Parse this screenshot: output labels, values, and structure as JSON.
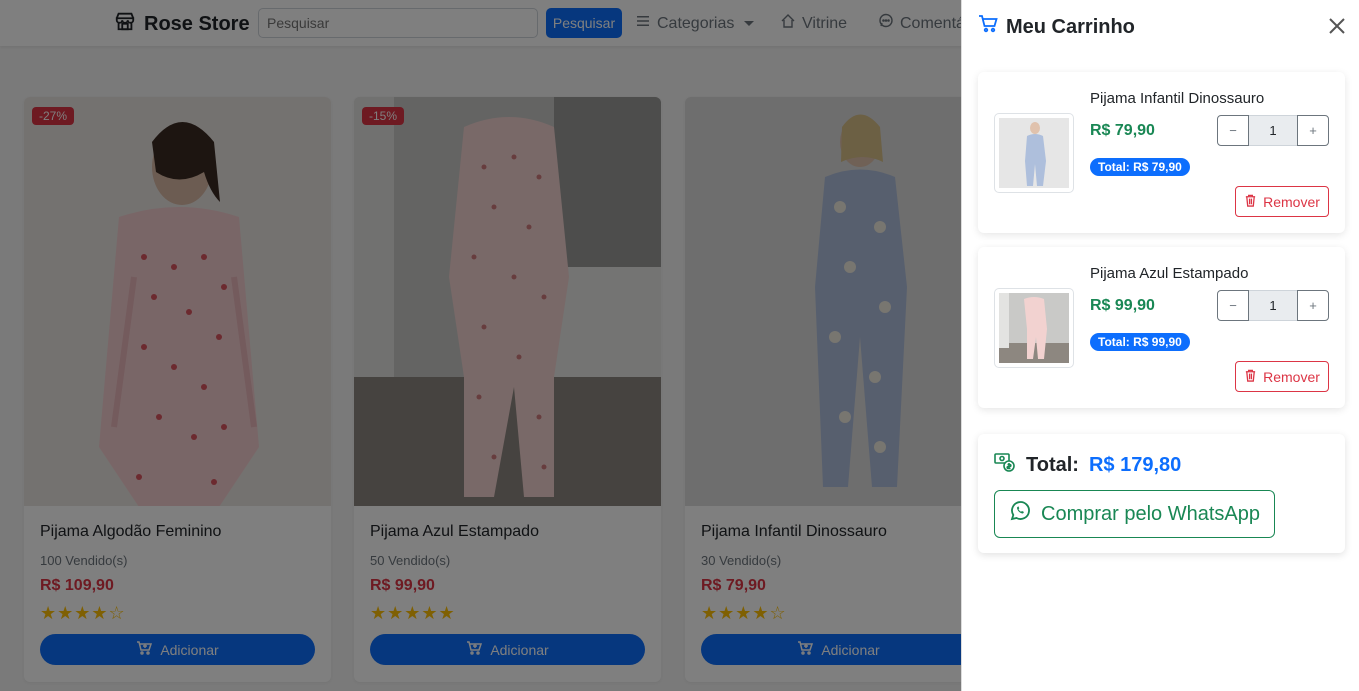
{
  "navbar": {
    "brand": "Rose Store",
    "search_placeholder": "Pesquisar",
    "search_button": "Pesquisar",
    "categories": "Categorias",
    "showcase": "Vitrine",
    "comments": "Comentá"
  },
  "products": [
    {
      "discount": "-27%",
      "title": "Pijama Algodão Feminino",
      "sold": "100 Vendido(s)",
      "price": "R$ 109,90",
      "stars": "★★★★☆",
      "rating": 4,
      "add": "Adicionar"
    },
    {
      "discount": "-15%",
      "title": "Pijama Azul Estampado",
      "sold": "50 Vendido(s)",
      "price": "R$ 99,90",
      "stars": "★★★★★",
      "rating": 5,
      "add": "Adicionar"
    },
    {
      "title": "Pijama Infantil Dinossauro",
      "sold": "30 Vendido(s)",
      "price": "R$ 79,90",
      "stars": "★★★★☆",
      "rating": 4,
      "add": "Adicionar"
    }
  ],
  "cart": {
    "title": "Meu Carrinho",
    "items": [
      {
        "name": "Pijama Infantil Dinossauro",
        "price": "R$ 79,90",
        "qty": "1",
        "minus": "−",
        "plus": "+",
        "subtotal": "Total: R$ 79,90",
        "remove": "Remover"
      },
      {
        "name": "Pijama Azul Estampado",
        "price": "R$ 99,90",
        "qty": "1",
        "minus": "−",
        "plus": "+",
        "subtotal": "Total: R$ 99,90",
        "remove": "Remover"
      }
    ],
    "total_label": "Total:",
    "total_value": "R$ 179,80",
    "whatsapp_button": "Comprar pelo WhatsApp"
  },
  "colors": {
    "primary": "#0d6efd",
    "danger": "#dc3545",
    "success": "#198754",
    "star": "#ffc107"
  }
}
